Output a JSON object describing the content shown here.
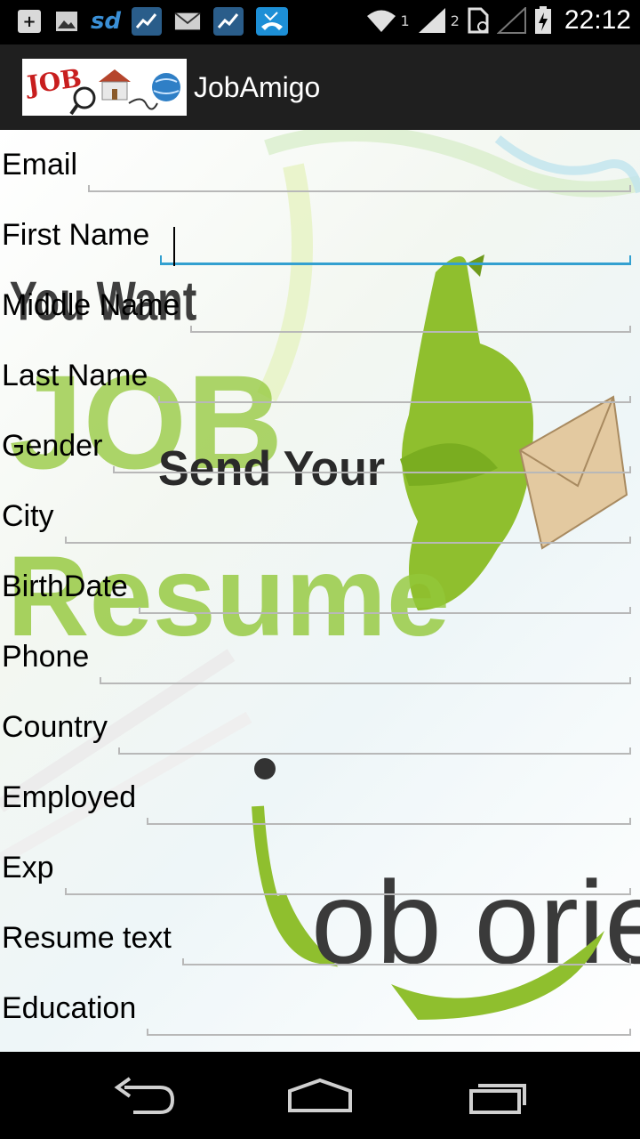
{
  "status_bar": {
    "icons": [
      "add-icon",
      "image-icon",
      "sd-card-icon",
      "stocks-icon",
      "mail-icon",
      "stocks-icon",
      "missed-call-icon",
      "wifi-icon",
      "signal-icon",
      "sim-icon",
      "battery-icon"
    ],
    "sd_text": "sd",
    "sim1": "1",
    "sim2": "2",
    "time": "22:12"
  },
  "action_bar": {
    "logo_text": "JOB",
    "title": "JobAmigo"
  },
  "background": {
    "text_you_want": "You Want",
    "text_job": "JOB",
    "text_send_your": "Send Your",
    "text_resume": "Resume",
    "text_job_orient": "ob orient"
  },
  "form": {
    "fields": [
      {
        "label": "Email",
        "value": ""
      },
      {
        "label": "First Name",
        "value": ""
      },
      {
        "label": "Middle Name",
        "value": ""
      },
      {
        "label": "Last Name",
        "value": ""
      },
      {
        "label": "Gender",
        "value": ""
      },
      {
        "label": "City",
        "value": ""
      },
      {
        "label": "BirthDate",
        "value": ""
      },
      {
        "label": "Phone",
        "value": ""
      },
      {
        "label": "Country",
        "value": ""
      },
      {
        "label": "Employed",
        "value": ""
      },
      {
        "label": "Exp",
        "value": ""
      },
      {
        "label": "Resume text",
        "value": ""
      },
      {
        "label": "Education",
        "value": ""
      }
    ],
    "focused_field": "First Name"
  },
  "nav_bar": {
    "buttons": [
      "back-icon",
      "home-icon",
      "recent-apps-icon"
    ]
  },
  "colors": {
    "focus_accent": "#33a0d0",
    "underline": "#b8b8b8",
    "bg_green": "#8bbb2a"
  }
}
